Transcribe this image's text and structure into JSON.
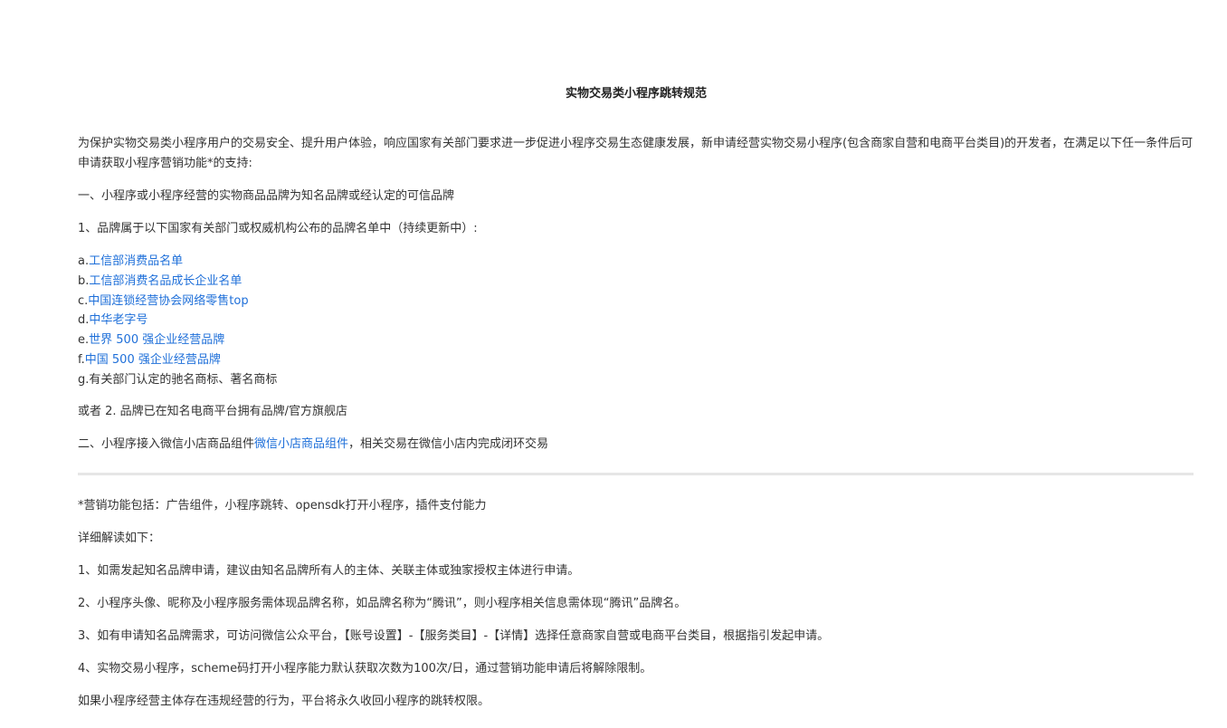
{
  "doc": {
    "title": "实物交易类小程序跳转规范",
    "intro": "为保护实物交易类小程序用户的交易安全、提升用户体验，响应国家有关部门要求进一步促进小程序交易生态健康发展，新申请经营实物交易小程序(包含商家自营和电商平台类目)的开发者，在满足以下任一条件后可申请获取小程序营销功能*的支持:",
    "section1": "一、小程序或小程序经营的实物商品品牌为知名品牌或经认定的可信品牌",
    "item1": "1、品牌属于以下国家有关部门或权威机构公布的品牌名单中（持续更新中）:",
    "list": [
      {
        "prefix": "a.",
        "text": "工信部消费品名单",
        "link": true
      },
      {
        "prefix": "b.",
        "text": "工信部消费名品成长企业名单",
        "link": true
      },
      {
        "prefix": "c.",
        "text": "中国连锁经营协会网络零售top",
        "link": true
      },
      {
        "prefix": "d.",
        "text": "中华老字号",
        "link": true
      },
      {
        "prefix": "e.",
        "text": "世界 500 强企业经营品牌",
        "link": true
      },
      {
        "prefix": "f.",
        "text": "中国 500 强企业经营品牌",
        "link": true
      },
      {
        "prefix": "g.",
        "text": "有关部门认定的驰名商标、著名商标",
        "link": false
      }
    ],
    "or2": "或者 2. 品牌已在知名电商平台拥有品牌/官方旗舰店",
    "section2_pre": "二、小程序接入微信小店商品组件",
    "section2_link": "微信小店商品组件",
    "section2_post": "，相关交易在微信小店内完成闭环交易",
    "note": "*营销功能包括：广告组件，小程序跳转、opensdk打开小程序，插件支付能力",
    "detail_heading": "详细解读如下：",
    "details": [
      "1、如需发起知名品牌申请，建议由知名品牌所有人的主体、关联主体或独家授权主体进行申请。",
      "2、小程序头像、昵称及小程序服务需体现品牌名称，如品牌名称为“腾讯”，则小程序相关信息需体现“腾讯”品牌名。",
      "3、如有申请知名品牌需求，可访问微信公众平台，【账号设置】-【服务类目】-【详情】选择任意商家自营或电商平台类目，根据指引发起申请。",
      "4、实物交易小程序，scheme码打开小程序能力默认获取次数为100次/日，通过营销功能申请后将解除限制。"
    ],
    "footer": "如果小程序经营主体存在违规经营的行为，平台将永久收回小程序的跳转权限。"
  },
  "colors": {
    "link": "#1e6fd9",
    "text": "#333333",
    "divider": "#e6e6e6"
  }
}
